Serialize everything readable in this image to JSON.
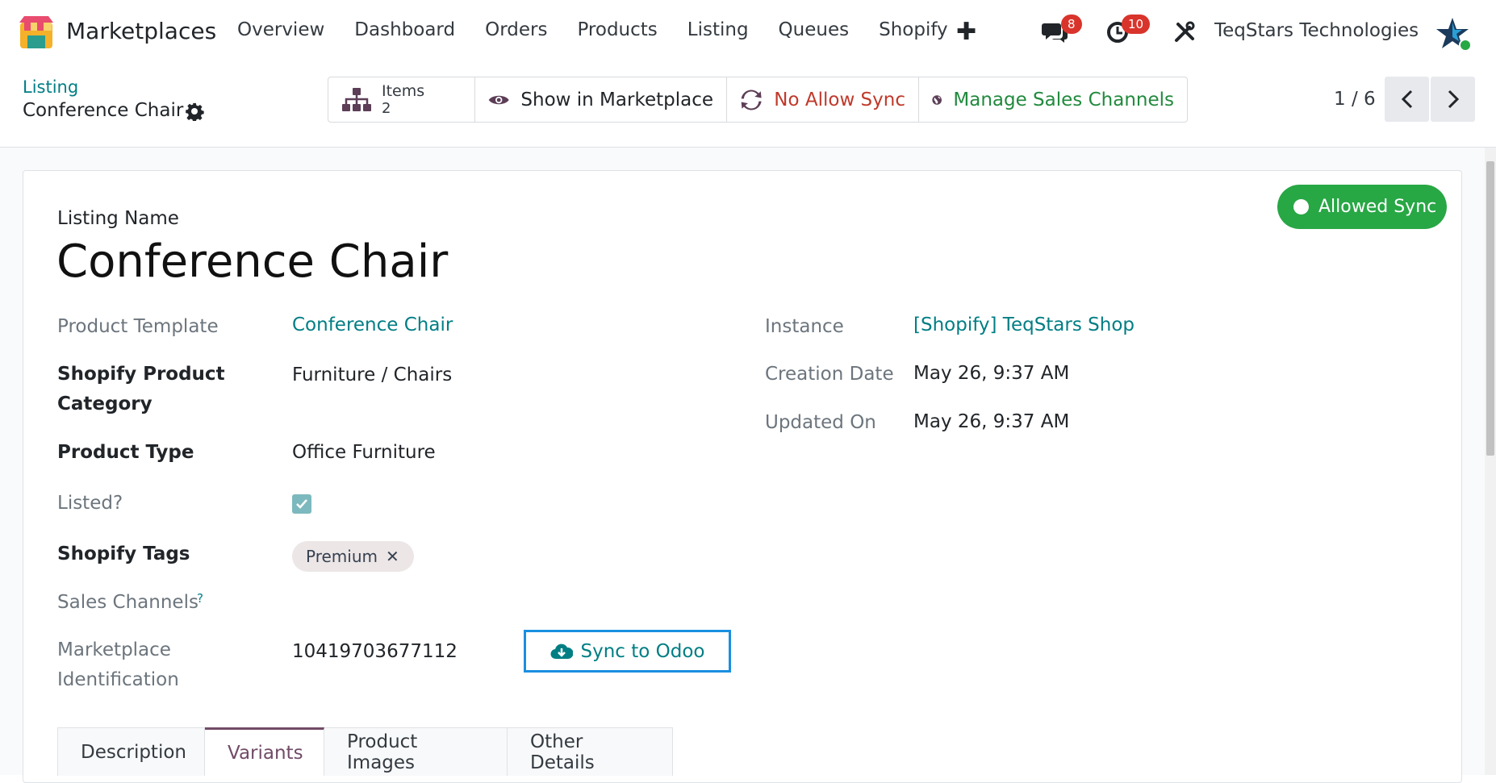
{
  "navbar": {
    "app_name": "Marketplaces",
    "menu": [
      "Overview",
      "Dashboard",
      "Orders",
      "Products",
      "Listing",
      "Queues",
      "Shopify"
    ],
    "messages_badge": "8",
    "activities_badge": "10",
    "company": "TeqStars Technologies"
  },
  "control_panel": {
    "breadcrumb": "Listing",
    "title": "Conference Chair",
    "items_label": "Items",
    "items_count": "2",
    "show_marketplace": "Show in Marketplace",
    "no_allow_sync": "No Allow Sync",
    "manage_channels": "Manage Sales Channels",
    "pager": "1 / 6"
  },
  "form": {
    "status": "Allowed Sync",
    "listing_name_label": "Listing Name",
    "listing_name": "Conference Chair",
    "product_template_label": "Product Template",
    "product_template": "Conference Chair",
    "category_label": "Shopify Product Category",
    "category": "Furniture / Chairs",
    "product_type_label": "Product Type",
    "product_type": "Office Furniture",
    "listed_label": "Listed?",
    "listed": true,
    "tags_label": "Shopify Tags",
    "tags": [
      "Premium"
    ],
    "channels_label": "Sales Channels",
    "channels_help": "?",
    "marketplace_id_label": "Marketplace Identification",
    "marketplace_id": "10419703677112",
    "sync_button": "Sync to Odoo",
    "instance_label": "Instance",
    "instance": "[Shopify] TeqStars Shop",
    "creation_label": "Creation Date",
    "creation": "May 26, 9:37 AM",
    "updated_label": "Updated On",
    "updated": "May 26, 9:37 AM"
  },
  "tabs": [
    "Description",
    "Variants",
    "Product Images",
    "Other Details"
  ],
  "active_tab": "Variants",
  "colors": {
    "primary": "#714b67",
    "link": "#017e84",
    "danger": "#c0392b",
    "success": "#28a745"
  }
}
